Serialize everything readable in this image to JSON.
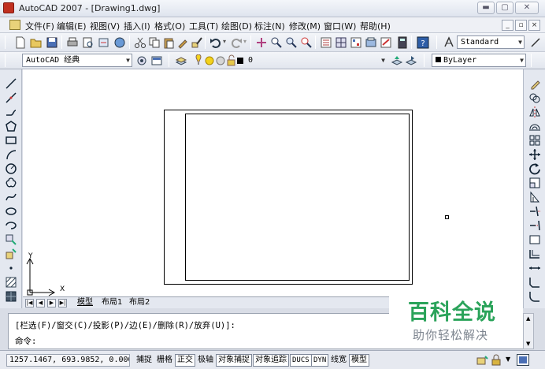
{
  "window": {
    "title": "AutoCAD 2007 - [Drawing1.dwg]",
    "controls": {
      "minimize": "▬",
      "maximize": "▢",
      "close": "✕"
    }
  },
  "menu": {
    "items": [
      "文件(F)",
      "编辑(E)",
      "视图(V)",
      "插入(I)",
      "格式(O)",
      "工具(T)",
      "绘图(D)",
      "标注(N)",
      "修改(M)",
      "窗口(W)",
      "帮助(H)"
    ],
    "mdi_controls": [
      "_",
      "▫",
      "×"
    ]
  },
  "standard_toolbar": {
    "icons": [
      "new-icon",
      "open-icon",
      "save-icon",
      "plot-icon",
      "plot-preview-icon",
      "publish-icon",
      "3d-dwf-icon",
      "cut-icon",
      "copy-icon",
      "paste-icon",
      "match-properties-icon",
      "block-editor-icon",
      "undo-icon",
      "redo-icon",
      "pan-icon",
      "zoom-realtime-icon",
      "zoom-window-icon",
      "zoom-previous-icon",
      "properties-icon",
      "design-center-icon",
      "tool-palettes-icon",
      "sheet-set-icon",
      "markup-icon",
      "calculator-icon",
      "help-icon"
    ],
    "text_style": "Standard"
  },
  "workspace_toolbar": {
    "workspace": "AutoCAD 经典",
    "layer": "0",
    "color": "ByLayer"
  },
  "draw_toolbar": {
    "icons": [
      "line-icon",
      "construction-line-icon",
      "polyline-icon",
      "polygon-icon",
      "rectangle-icon",
      "arc-icon",
      "circle-icon",
      "revision-cloud-icon",
      "spline-icon",
      "ellipse-icon",
      "ellipse-arc-icon",
      "insert-block-icon",
      "make-block-icon",
      "point-icon",
      "hatch-icon",
      "gradient-icon"
    ]
  },
  "modify_toolbar": {
    "icons": [
      "erase-icon",
      "copy-object-icon",
      "mirror-icon",
      "offset-icon",
      "array-icon",
      "move-icon",
      "rotate-icon",
      "scale-icon",
      "stretch-icon",
      "trim-icon",
      "extend-icon",
      "break-at-point-icon",
      "break-icon",
      "join-icon",
      "chamfer-icon",
      "fillet-icon"
    ]
  },
  "canvas": {
    "ucs": {
      "x_label": "X",
      "y_label": "Y"
    }
  },
  "layout_tabs": {
    "nav": [
      "|◀",
      "◀",
      "▶",
      "▶|"
    ],
    "tabs": [
      "模型",
      "布局1",
      "布局2"
    ],
    "active": "模型"
  },
  "command_window": {
    "history_line": "[栏选(F)/窗交(C)/投影(P)/边(E)/删除(R)/放弃(U)]:",
    "prompt": "命令:"
  },
  "status_bar": {
    "coordinates": "1257.1467, 693.9852, 0.0000",
    "toggles": [
      {
        "label": "捕捉",
        "on": false
      },
      {
        "label": "栅格",
        "on": false
      },
      {
        "label": "正交",
        "on": true
      },
      {
        "label": "极轴",
        "on": false
      },
      {
        "label": "对象捕捉",
        "on": true
      },
      {
        "label": "对象追踪",
        "on": true
      },
      {
        "label": "DUCS",
        "on": true
      },
      {
        "label": "DYN",
        "on": true
      },
      {
        "label": "线宽",
        "on": false
      },
      {
        "label": "模型",
        "on": true
      }
    ]
  },
  "watermark": {
    "title": "百科全说",
    "subtitle": "助你轻松解决"
  },
  "colors": {
    "canvas_bg": "#ffffff",
    "chrome_bg": "#e4e8f0",
    "watermark_green": "#2aa35a",
    "watermark_gray": "#7d858f"
  }
}
